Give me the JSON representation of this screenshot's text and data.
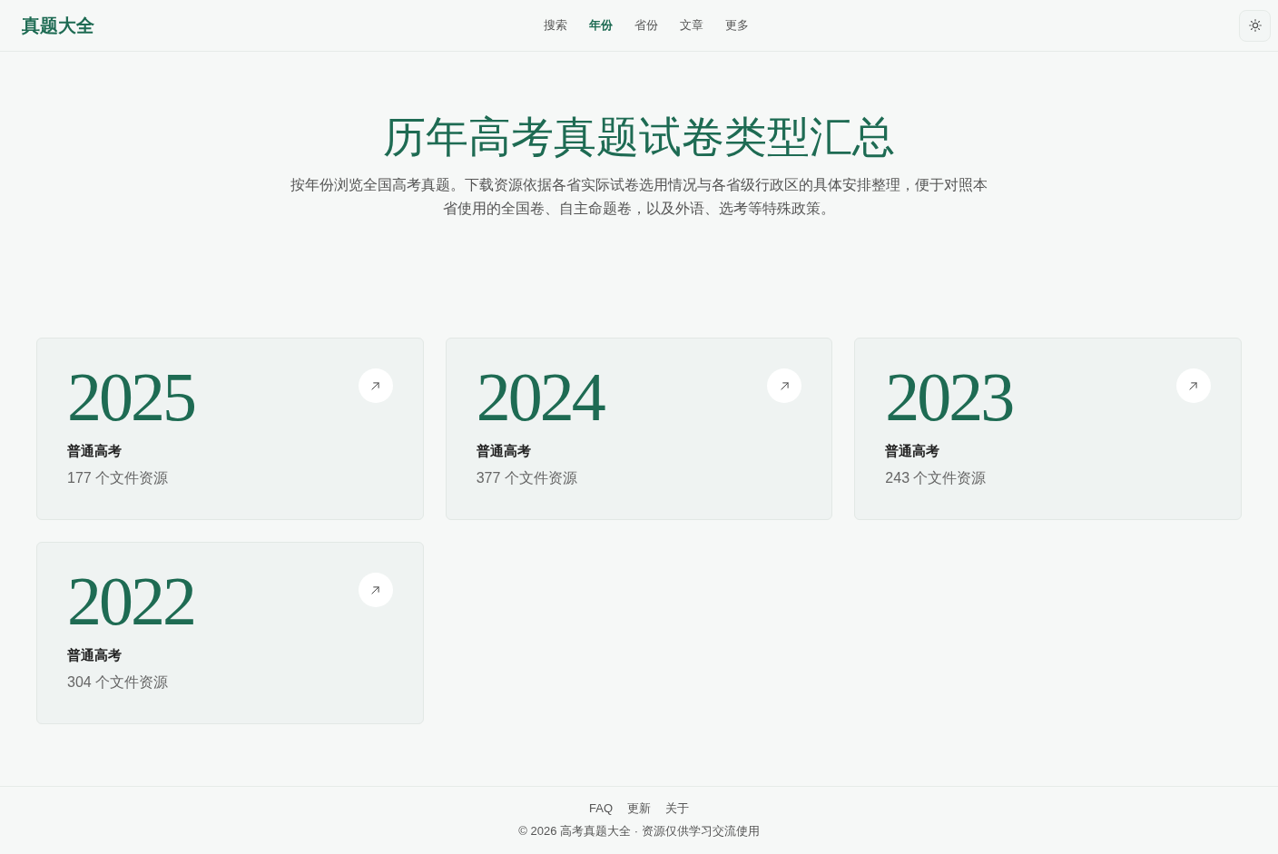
{
  "header": {
    "logo": "真题大全",
    "nav": [
      {
        "label": "搜索",
        "selected": false
      },
      {
        "label": "年份",
        "selected": true
      },
      {
        "label": "省份",
        "selected": false
      },
      {
        "label": "文章",
        "selected": false
      },
      {
        "label": "更多",
        "selected": false
      }
    ]
  },
  "hero": {
    "title": "历年高考真题试卷类型汇总",
    "description": "按年份浏览全国高考真题。下载资源依据各省实际试卷选用情况与各省级行政区的具体安排整理，便于对照本省使用的全国卷、自主命题卷，以及外语、选考等特殊政策。"
  },
  "years": [
    {
      "year": "2025",
      "label": "普通高考",
      "count": "177 个文件资源"
    },
    {
      "year": "2024",
      "label": "普通高考",
      "count": "377 个文件资源"
    },
    {
      "year": "2023",
      "label": "普通高考",
      "count": "243 个文件资源"
    },
    {
      "year": "2022",
      "label": "普通高考",
      "count": "304 个文件资源"
    }
  ],
  "footer": {
    "links": [
      "FAQ",
      "更新",
      "关于"
    ],
    "copyright": "© 2026 高考真题大全 · 资源仅供学习交流使用"
  }
}
